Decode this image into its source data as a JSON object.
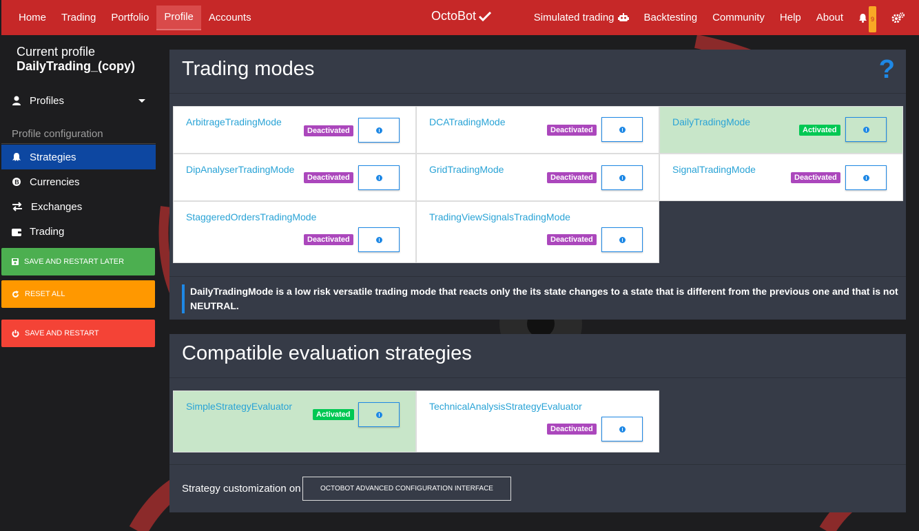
{
  "navbar": {
    "left_items": [
      "Home",
      "Trading",
      "Portfolio",
      "Profile",
      "Accounts"
    ],
    "active_item": "Profile",
    "brand": "OctoBot",
    "right_items": {
      "simulated": "Simulated trading",
      "backtesting": "Backtesting",
      "community": "Community",
      "help": "Help",
      "about": "About",
      "notifications_count": "9"
    },
    "icons": [
      "check-icon",
      "robot-icon",
      "bell-icon",
      "gears-icon"
    ]
  },
  "sidebar": {
    "current_profile_label": "Current profile",
    "current_profile_name": "DailyTrading_(copy)",
    "profiles_label": "Profiles",
    "section_header": "Profile configuration",
    "items": [
      {
        "label": "Strategies",
        "icon": "octopus-icon",
        "selected": true
      },
      {
        "label": "Currencies",
        "icon": "bitcoin-icon",
        "selected": false
      },
      {
        "label": "Exchanges",
        "icon": "exchange-arrows-icon",
        "selected": false
      },
      {
        "label": "Trading",
        "icon": "wallet-icon",
        "selected": false
      }
    ],
    "buttons": {
      "save_later": "SAVE AND RESTART LATER",
      "reset": "RESET ALL",
      "save_restart": "SAVE AND RESTART"
    }
  },
  "trading_modes": {
    "title": "Trading modes",
    "help": "?",
    "tiles": [
      {
        "name": "ArbitrageTradingMode",
        "status": "Deactivated"
      },
      {
        "name": "DCATradingMode",
        "status": "Deactivated"
      },
      {
        "name": "DailyTradingMode",
        "status": "Activated"
      },
      {
        "name": "DipAnalyserTradingMode",
        "status": "Deactivated"
      },
      {
        "name": "GridTradingMode",
        "status": "Deactivated"
      },
      {
        "name": "SignalTradingMode",
        "status": "Deactivated"
      },
      {
        "name": "StaggeredOrdersTradingMode",
        "status": "Deactivated"
      },
      {
        "name": "TradingViewSignalsTradingMode",
        "status": "Deactivated"
      }
    ],
    "description": "DailyTradingMode is a low risk versatile trading mode that reacts only the its state changes to a state that is different from the previous one and that is not NEUTRAL."
  },
  "strategies": {
    "title": "Compatible evaluation strategies",
    "tiles": [
      {
        "name": "SimpleStrategyEvaluator",
        "status": "Activated"
      },
      {
        "name": "TechnicalAnalysisStrategyEvaluator",
        "status": "Deactivated"
      }
    ],
    "customization_label": "Strategy customization on",
    "advanced_button": "OCTOBOT ADVANCED CONFIGURATION INTERFACE"
  },
  "colors": {
    "navbar": "#c62828",
    "selected_sidebar": "#0d47a1",
    "card_bg": "#363b47",
    "activated_tile": "#c8e6c9",
    "deactivated_tag": "#ab47bc",
    "activated_tag": "#00c853",
    "link": "#29a3d6"
  }
}
